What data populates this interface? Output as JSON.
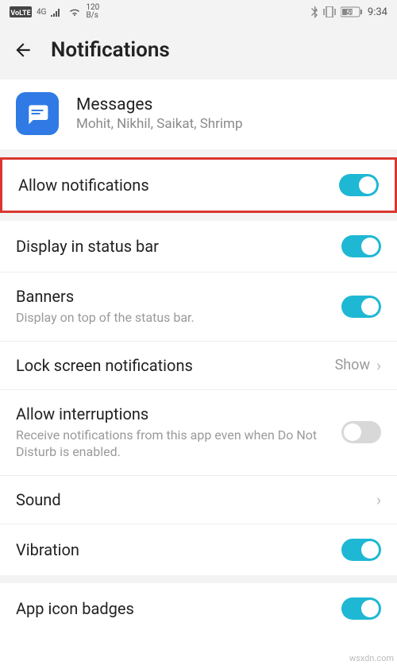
{
  "status": {
    "volte": "VoLTE",
    "net1": "4G",
    "speed_top": "120",
    "speed_bot": "B/s",
    "battery": "59",
    "time": "9:34"
  },
  "header": {
    "title": "Notifications"
  },
  "app": {
    "name": "Messages",
    "subtitle": "Mohit, Nikhil, Saikat, Shrimp"
  },
  "settings": {
    "allow": {
      "label": "Allow notifications",
      "on": true
    },
    "statusbar": {
      "label": "Display in status bar",
      "on": true
    },
    "banners": {
      "label": "Banners",
      "sub": "Display on top of the status bar.",
      "on": true
    },
    "lockscreen": {
      "label": "Lock screen notifications",
      "value": "Show"
    },
    "interruptions": {
      "label": "Allow interruptions",
      "sub": "Receive notifications from this app even when Do Not Disturb is enabled.",
      "on": false
    },
    "sound": {
      "label": "Sound"
    },
    "vibration": {
      "label": "Vibration",
      "on": true
    },
    "badges": {
      "label": "App icon badges",
      "on": true
    }
  },
  "watermark": "wsxdn.com"
}
